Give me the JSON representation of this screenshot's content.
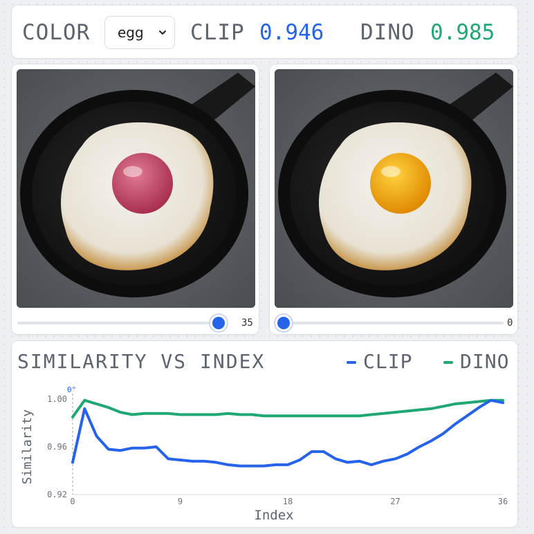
{
  "header": {
    "color_label": "COLOR",
    "color_selected": "egg",
    "clip_label": "CLIP",
    "clip_value": "0.946",
    "dino_label": "DINO",
    "dino_value": "0.985"
  },
  "panels": {
    "left": {
      "slider_value": "35",
      "slider_fraction": 0.97,
      "yolk_color": "#c2415f"
    },
    "right": {
      "slider_value": "0",
      "slider_fraction": 0.0,
      "yolk_color": "#f2a900"
    }
  },
  "colors": {
    "clip": "#2563eb",
    "dino": "#1fa874"
  },
  "chart_data": {
    "type": "line",
    "title": "SIMILARITY VS INDEX",
    "xlabel": "Index",
    "ylabel": "Similarity",
    "xlim": [
      0,
      36
    ],
    "ylim": [
      0.92,
      1.0
    ],
    "xticks": [
      0,
      9,
      18,
      27,
      36
    ],
    "yticks": [
      0.92,
      0.96,
      1.0
    ],
    "xtick_labels": [
      "0",
      "9",
      "18",
      "27",
      "36"
    ],
    "ytick_labels": [
      "0.92",
      "0.96",
      "1.00"
    ],
    "marker_label": "0°",
    "marker_x": 0,
    "legend": "top-right",
    "x": [
      0,
      1,
      2,
      3,
      4,
      5,
      6,
      7,
      8,
      9,
      10,
      11,
      12,
      13,
      14,
      15,
      16,
      17,
      18,
      19,
      20,
      21,
      22,
      23,
      24,
      25,
      26,
      27,
      28,
      29,
      30,
      31,
      32,
      33,
      34,
      35,
      36
    ],
    "series": [
      {
        "name": "CLIP",
        "values": [
          0.947,
          0.992,
          0.969,
          0.958,
          0.957,
          0.959,
          0.959,
          0.96,
          0.95,
          0.949,
          0.948,
          0.948,
          0.947,
          0.945,
          0.944,
          0.944,
          0.944,
          0.945,
          0.945,
          0.949,
          0.956,
          0.956,
          0.95,
          0.947,
          0.948,
          0.945,
          0.948,
          0.95,
          0.954,
          0.96,
          0.965,
          0.971,
          0.979,
          0.986,
          0.993,
          0.999,
          0.997
        ]
      },
      {
        "name": "DINO",
        "values": [
          0.985,
          0.999,
          0.996,
          0.993,
          0.989,
          0.987,
          0.988,
          0.988,
          0.988,
          0.987,
          0.987,
          0.987,
          0.987,
          0.988,
          0.987,
          0.987,
          0.986,
          0.986,
          0.986,
          0.986,
          0.986,
          0.986,
          0.986,
          0.986,
          0.986,
          0.987,
          0.988,
          0.989,
          0.99,
          0.991,
          0.992,
          0.994,
          0.996,
          0.997,
          0.998,
          0.999,
          0.999
        ]
      }
    ]
  }
}
